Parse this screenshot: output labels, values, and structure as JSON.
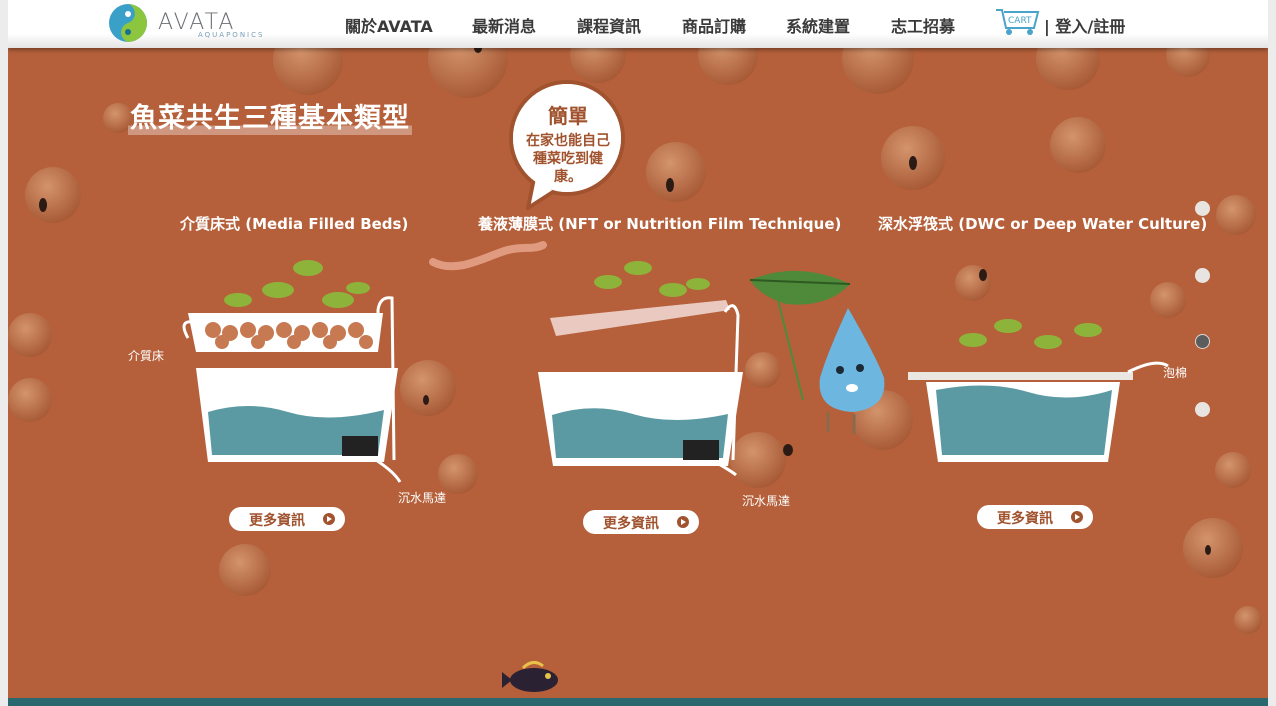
{
  "header": {
    "brand": "AVATA",
    "brand_sub": "AQUAPONICS",
    "nav": [
      "關於AVATA",
      "最新消息",
      "課程資訊",
      "商品訂購",
      "系統建置",
      "志工招募"
    ],
    "cart": "CART",
    "login": "| 登入/註冊"
  },
  "main": {
    "title": "魚菜共生三種基本類型",
    "bubble": {
      "title": "簡單",
      "text": "在家也能自己種菜吃到健康。"
    },
    "types": [
      {
        "title": "介質床式 (Media Filled Beds)",
        "label_left": "介質床",
        "label_pump": "沉水馬達",
        "more": "更多資訊"
      },
      {
        "title": "養液薄膜式 (NFT or Nutrition Film Technique)",
        "label_pump": "沉水馬達",
        "more": "更多資訊"
      },
      {
        "title": "深水浮筏式 (DWC or Deep Water Culture)",
        "label_right": "泡棉",
        "more": "更多資訊"
      }
    ]
  },
  "pager": {
    "count": 4,
    "active_index": 2
  },
  "colors": {
    "background": "#b5603a",
    "water": "#5b9aa3",
    "plant": "#8db33a",
    "accent_text": "#a0532e"
  }
}
